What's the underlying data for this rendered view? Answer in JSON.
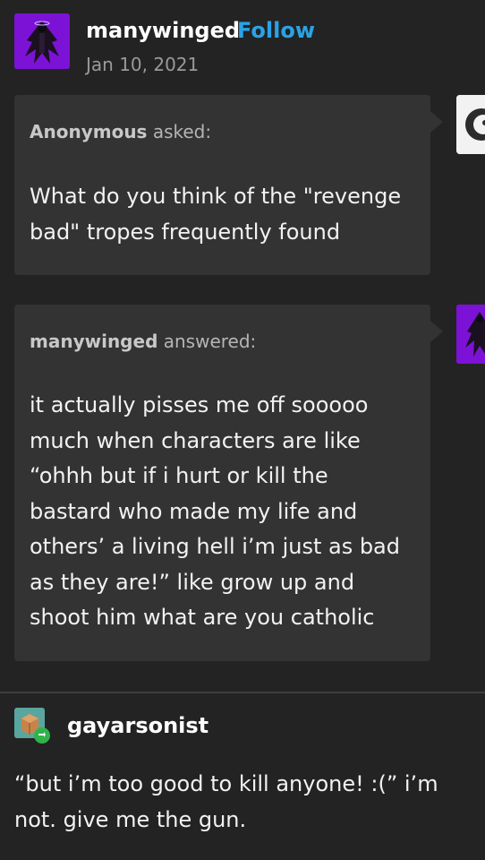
{
  "post": {
    "username": "manywinged",
    "follow_label": "Follow",
    "date": "Jan 10, 2021",
    "ask": {
      "asker": "Anonymous",
      "verb": "asked:",
      "text": "What do you think of the \"revenge bad\" tropes frequently found"
    },
    "answer": {
      "answerer": "manywinged",
      "verb": "answered:",
      "text": "it actually pisses me off sooooo much when characters are like “ohhh but if i hurt or kill the bastard who made my life and others’ a living hell i’m just as bad as they are!” like grow up and shoot him what are you catholic"
    }
  },
  "reblog": {
    "username": "gayarsonist",
    "text": "“but i’m too good to kill anyone! :(” i’m not. give me the gun."
  },
  "colors": {
    "background": "#232323",
    "bubble": "#333333",
    "follow_blue": "#2aa3e6",
    "avatar_purple": "#7b12d6",
    "reblog_green": "#2fb34a"
  },
  "icons": [
    "avatar-image",
    "reblog-icon",
    "box-avatar-icon"
  ]
}
